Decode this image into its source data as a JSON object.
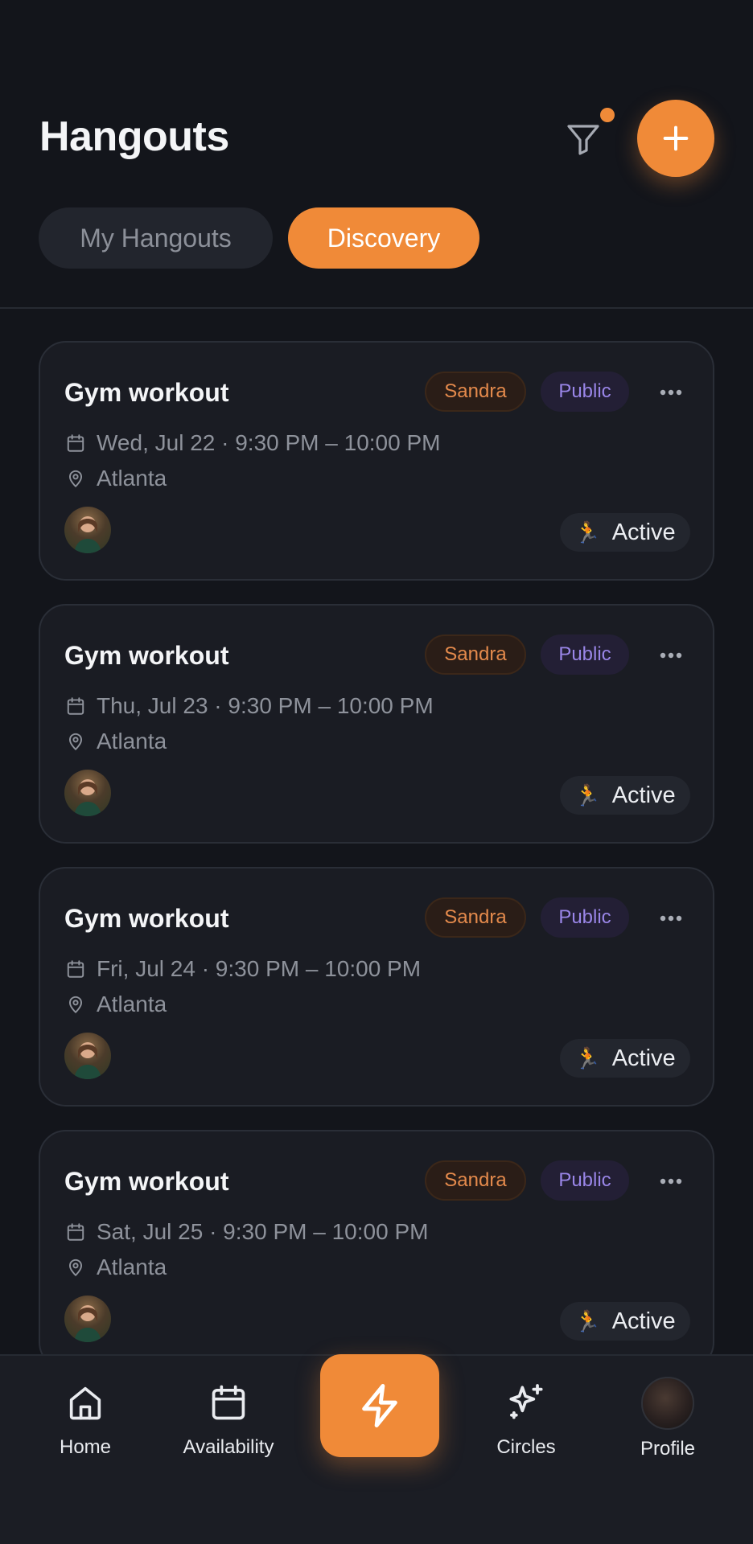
{
  "header": {
    "title": "Hangouts",
    "filter_icon": "filter-icon",
    "filter_badge_color": "#f08a38",
    "add_icon": "plus-icon"
  },
  "tabs": [
    {
      "label": "My Hangouts",
      "active": false
    },
    {
      "label": "Discovery",
      "active": true
    }
  ],
  "cards": [
    {
      "title": "Gym workout",
      "host": "Sandra",
      "visibility": "Public",
      "date": "Wed, Jul 22 · 9:30 PM – 10:00 PM",
      "location": "Atlanta",
      "status_emoji": "🏃",
      "status": "Active"
    },
    {
      "title": "Gym workout",
      "host": "Sandra",
      "visibility": "Public",
      "date": "Thu, Jul 23 · 9:30 PM – 10:00 PM",
      "location": "Atlanta",
      "status_emoji": "🏃",
      "status": "Active"
    },
    {
      "title": "Gym workout",
      "host": "Sandra",
      "visibility": "Public",
      "date": "Fri, Jul 24 · 9:30 PM – 10:00 PM",
      "location": "Atlanta",
      "status_emoji": "🏃",
      "status": "Active"
    },
    {
      "title": "Gym workout",
      "host": "Sandra",
      "visibility": "Public",
      "date": "Sat, Jul 25 · 9:30 PM – 10:00 PM",
      "location": "Atlanta",
      "status_emoji": "🏃",
      "status": "Active"
    }
  ],
  "nav": {
    "home": "Home",
    "availability": "Availability",
    "center_icon": "lightning-icon",
    "circles": "Circles",
    "profile": "Profile"
  },
  "colors": {
    "accent": "#f08a38",
    "background": "#13151b",
    "card": "#1a1c23",
    "host_badge_text": "#e48a4c",
    "public_badge_text": "#9a86e8"
  }
}
